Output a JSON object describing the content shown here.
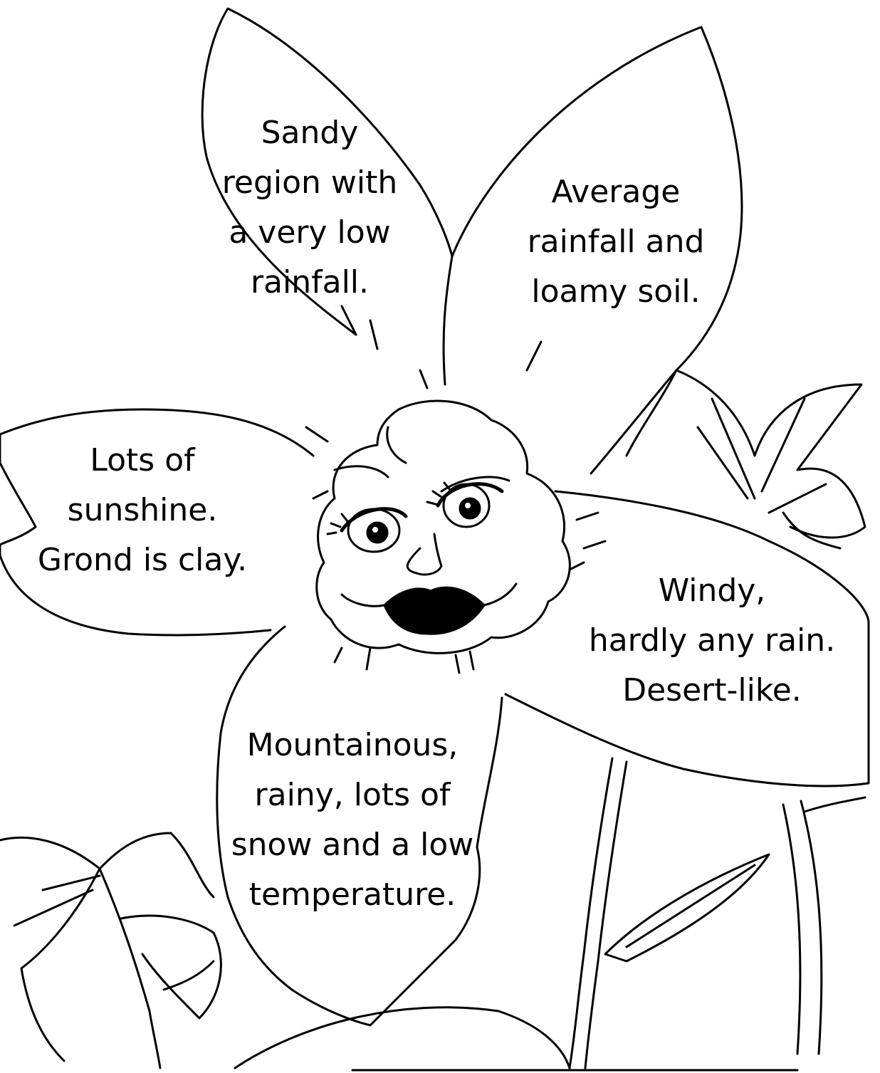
{
  "petals": [
    {
      "id": "sandy",
      "text": "Sandy\nregion with\na very low\nrainfall."
    },
    {
      "id": "average",
      "text": "Average\nrainfall and\nloamy soil."
    },
    {
      "id": "sunshine",
      "text": "Lots of\nsunshine.\nGrond is clay."
    },
    {
      "id": "windy",
      "text": "Windy,\nhardly any rain.\nDesert-like."
    },
    {
      "id": "mountainous",
      "text": "Mountainous,\nrainy, lots of\nsnow and a low\ntemperature."
    }
  ],
  "colors": {
    "ink": "#000000",
    "paper": "#ffffff"
  }
}
